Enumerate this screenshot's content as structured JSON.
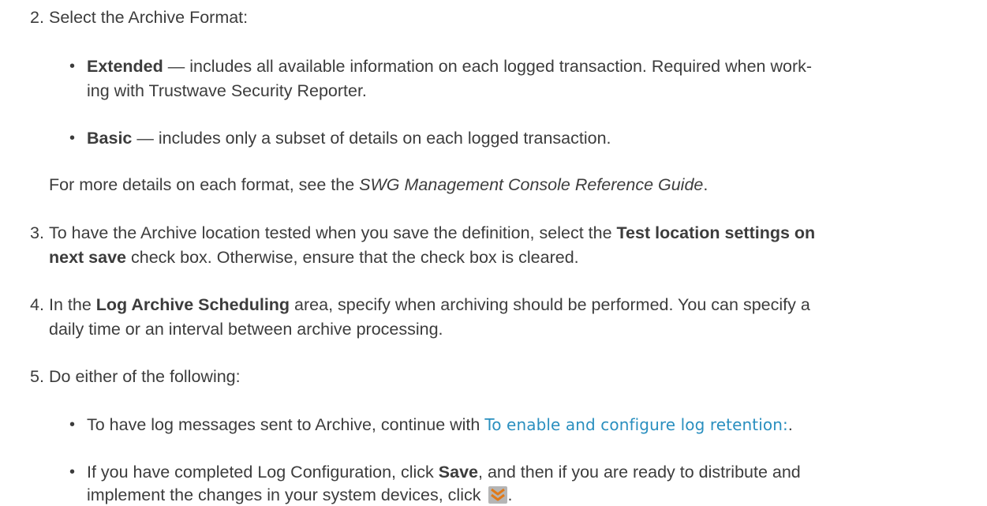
{
  "step2": {
    "number": "2.",
    "text": "Select the Archive Format:",
    "bullets": [
      {
        "bold": "Extended",
        "rest": " — includes all available information on each logged transaction. Required when work-",
        "cont": "ing with Trustwave Security Reporter."
      },
      {
        "bold": "Basic",
        "rest": " — includes only a subset of details on each logged transaction."
      }
    ],
    "more_prefix": "For more details on each format, see the ",
    "more_italic": "SWG Management Console Reference Guide",
    "more_suffix": "."
  },
  "step3": {
    "number": "3.",
    "line1_pre": "To have the Archive location tested when you save the definition, select the ",
    "line1_bold": "Test location settings on",
    "line2_bold": "next save",
    "line2_rest": " check box. Otherwise, ensure that the check box is cleared."
  },
  "step4": {
    "number": "4.",
    "line1_pre": "In the ",
    "line1_bold": "Log Archive Scheduling",
    "line1_rest": " area, specify when archiving should be performed. You can specify a",
    "line2": "daily time or an interval between archive processing."
  },
  "step5": {
    "number": "5.",
    "text": "Do either of the following:",
    "bullet1_pre": "To have log messages sent to Archive, continue with ",
    "bullet1_link": "To enable and configure log retention:",
    "bullet1_suffix": ".",
    "bullet2_pre": "If you have completed Log Configuration, click ",
    "bullet2_bold": "Save",
    "bullet2_rest": ", and then if you are ready to distribute and",
    "bullet2_line2": "implement the changes in your system devices, click ",
    "bullet2_suffix": ".",
    "icon": "deploy-chevrons-icon"
  }
}
